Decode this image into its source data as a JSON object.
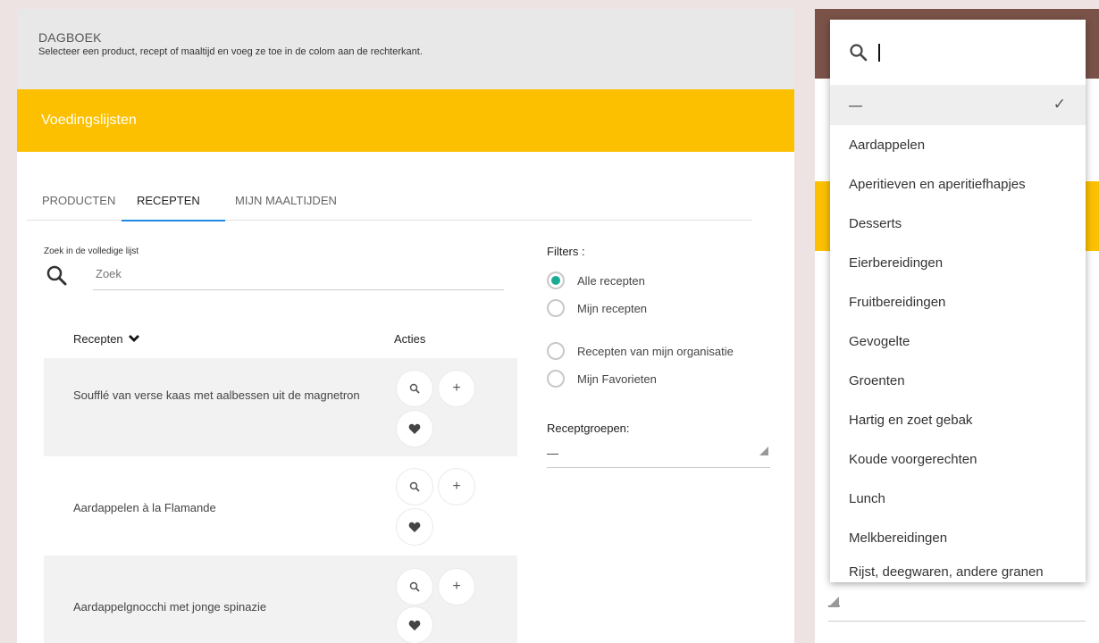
{
  "header": {
    "title": "DAGBOEK",
    "subtitle": "Selecteer een product, recept of maaltijd en voeg ze toe in de colom aan de rechterkant."
  },
  "section_title": "Voedingslijsten",
  "tabs": [
    {
      "label": "PRODUCTEN",
      "active": false
    },
    {
      "label": "RECEPTEN",
      "active": true
    },
    {
      "label": "MIJN MAALTIJDEN",
      "active": false
    }
  ],
  "search": {
    "label": "Zoek in de volledige lijst",
    "placeholder": "Zoek"
  },
  "list": {
    "col_recipes": "Recepten",
    "col_actions": "Acties",
    "rows": [
      {
        "name": "Soufflé van verse kaas met aalbessen uit de magnetron"
      },
      {
        "name": "Aardappelen à la Flamande"
      },
      {
        "name": "Aardappelgnocchi met jonge spinazie"
      }
    ]
  },
  "filters": {
    "title": "Filters :",
    "options": [
      {
        "label": "Alle recepten",
        "selected": true
      },
      {
        "label": "Mijn recepten",
        "selected": false
      },
      {
        "label": "Recepten van mijn organisatie",
        "selected": false
      },
      {
        "label": "Mijn Favorieten",
        "selected": false
      }
    ],
    "groups_label": "Receptgroepen:",
    "groups_value": "—"
  },
  "dropdown": {
    "search_value": "",
    "items": [
      {
        "label": "—",
        "selected": true
      },
      {
        "label": "Aardappelen",
        "selected": false
      },
      {
        "label": "Aperitieven en aperitiefhapjes",
        "selected": false
      },
      {
        "label": "Desserts",
        "selected": false
      },
      {
        "label": "Eierbereidingen",
        "selected": false
      },
      {
        "label": "Fruitbereidingen",
        "selected": false
      },
      {
        "label": "Gevogelte",
        "selected": false
      },
      {
        "label": "Groenten",
        "selected": false
      },
      {
        "label": "Hartig en zoet gebak",
        "selected": false
      },
      {
        "label": "Koude voorgerechten",
        "selected": false
      },
      {
        "label": "Lunch",
        "selected": false
      },
      {
        "label": "Melkbereidingen",
        "selected": false
      },
      {
        "label": "Rijst, deegwaren, andere granen",
        "selected": false
      }
    ]
  },
  "side_select_value": "—",
  "icons": {
    "search": "search-icon",
    "zoom": "magnifier-icon",
    "add": "plus-icon",
    "favorite": "heart-icon",
    "sort": "chevron-down-icon",
    "check": "checkmark-icon"
  },
  "colors": {
    "accent_yellow": "#fcc000",
    "tab_underline": "#1e88e5",
    "radio_selected": "#1aab95",
    "side_header": "#7a5248"
  }
}
